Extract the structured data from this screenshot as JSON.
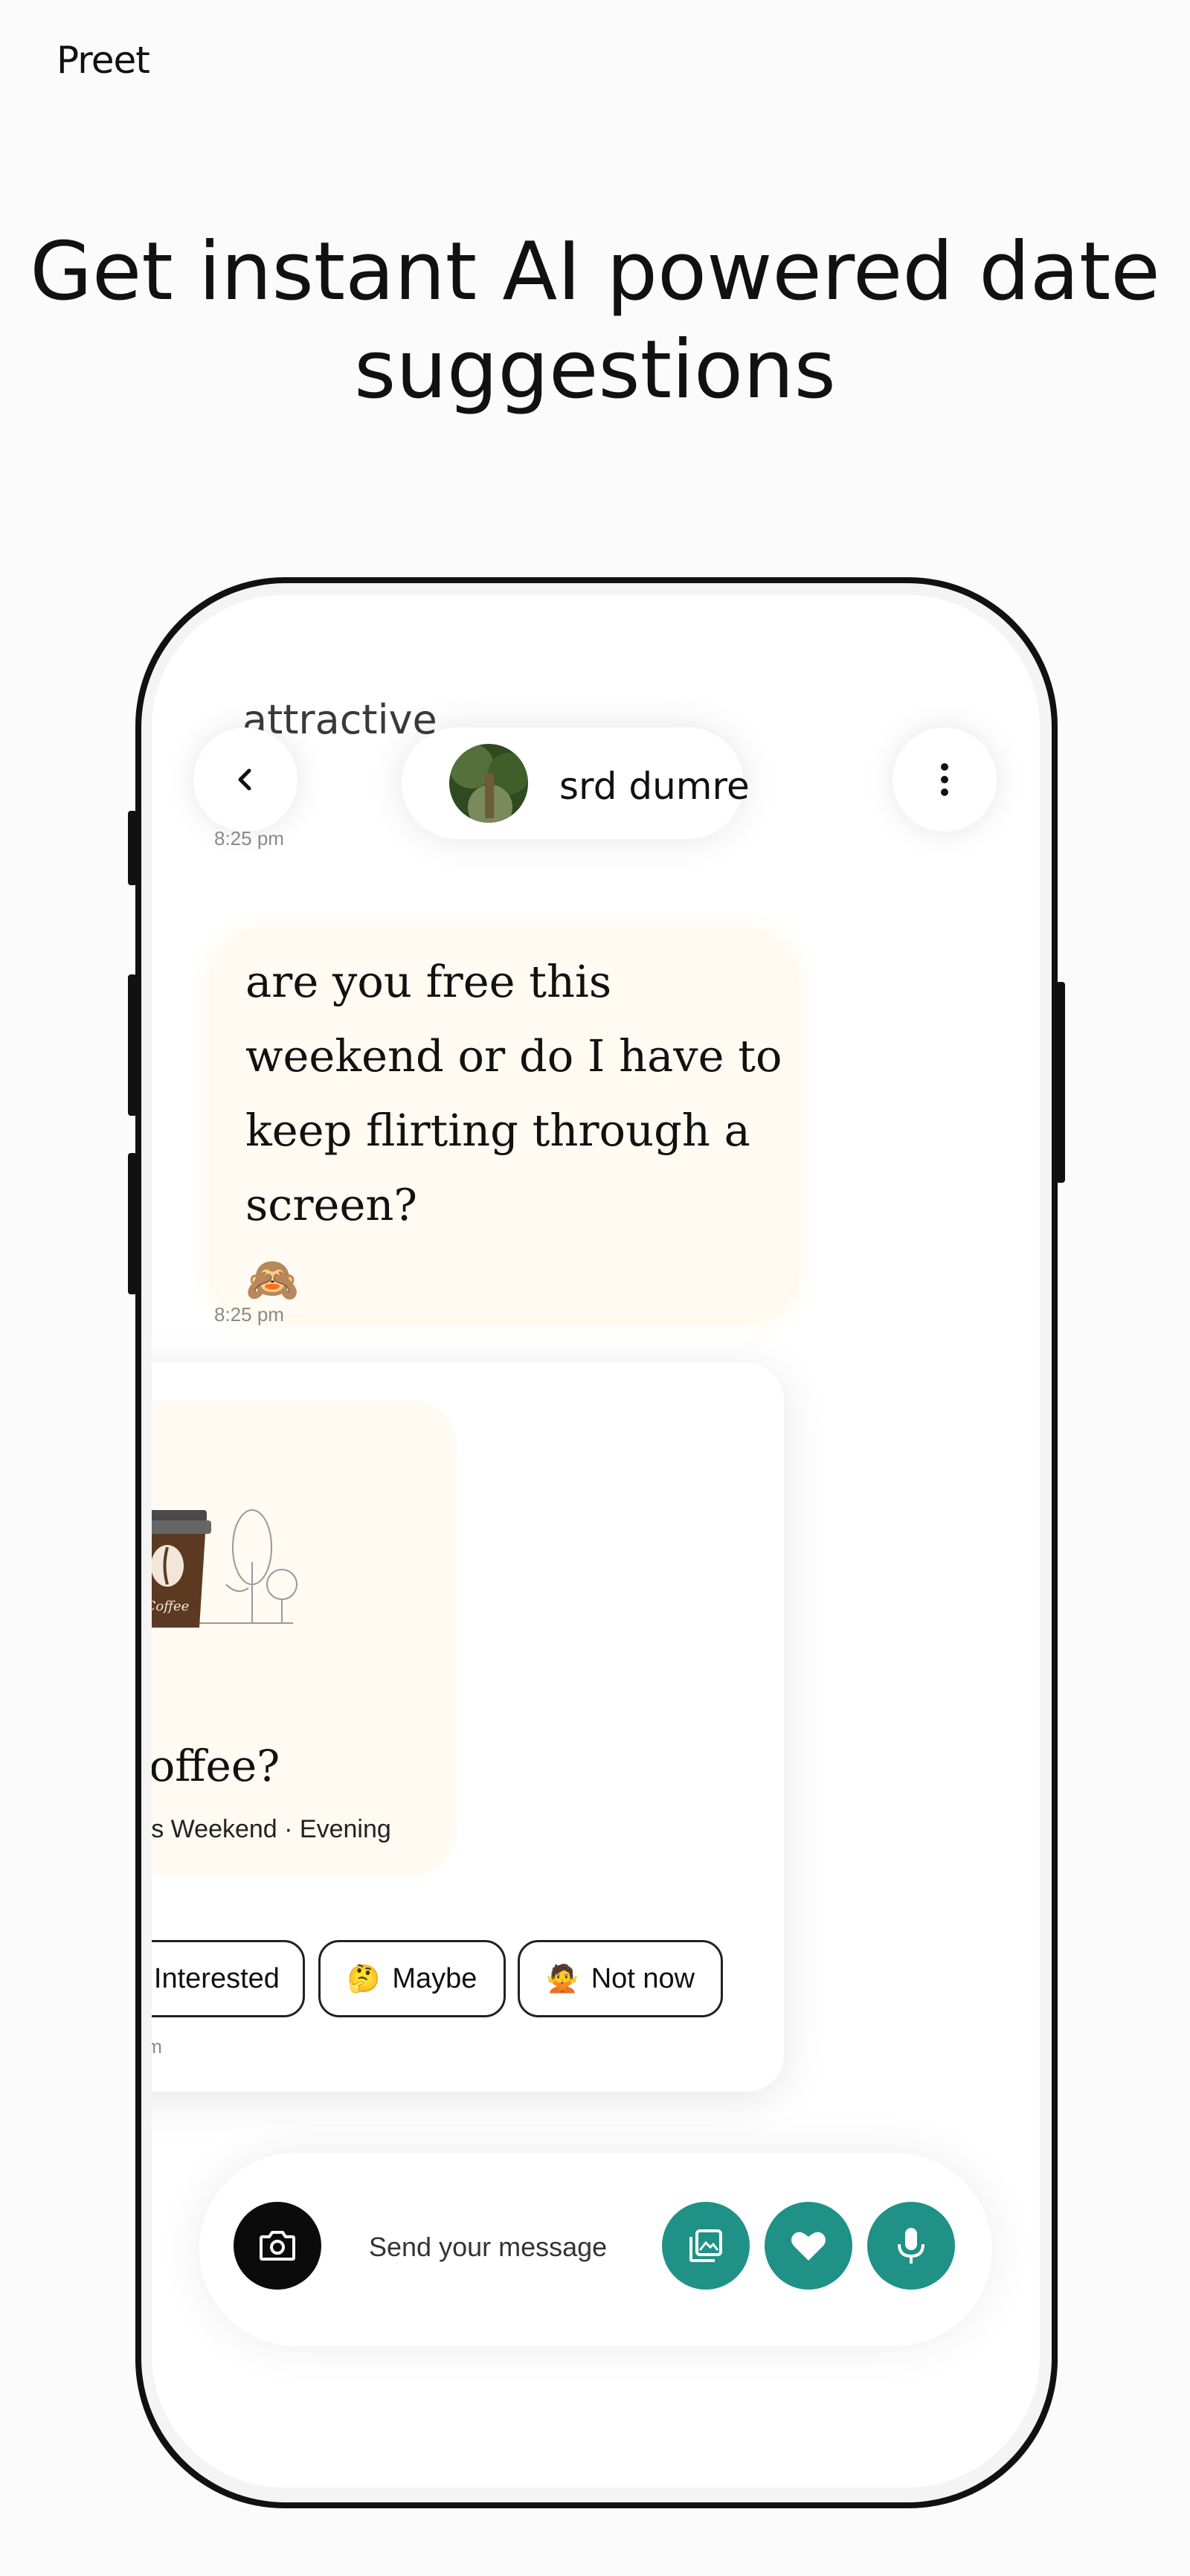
{
  "brand": "Preet",
  "headline": "Get instant AI powered date suggestions",
  "chat": {
    "previous_message_fragment": "attractive",
    "header": {
      "name": "srd dumre"
    },
    "times": [
      "8:25 pm",
      "8:25 pm",
      "8:27 pm"
    ],
    "message": {
      "text": "are you free this weekend or do I have to keep flirting through a screen?",
      "emoji": "🙈"
    },
    "suggestion": {
      "title": "Coffee?",
      "subtitle": "This Weekend · Evening",
      "cup_label": "Coffee",
      "actions": [
        {
          "icon": "🖤",
          "label": "Interested"
        },
        {
          "icon": "🤔",
          "label": "Maybe"
        },
        {
          "icon": "🙅",
          "label": "Not now"
        }
      ]
    },
    "composer": {
      "placeholder": "Send your message"
    }
  },
  "colors": {
    "accent": "#1f9187",
    "bubble": "#fffbf2",
    "dark": "#0b0b0b"
  }
}
